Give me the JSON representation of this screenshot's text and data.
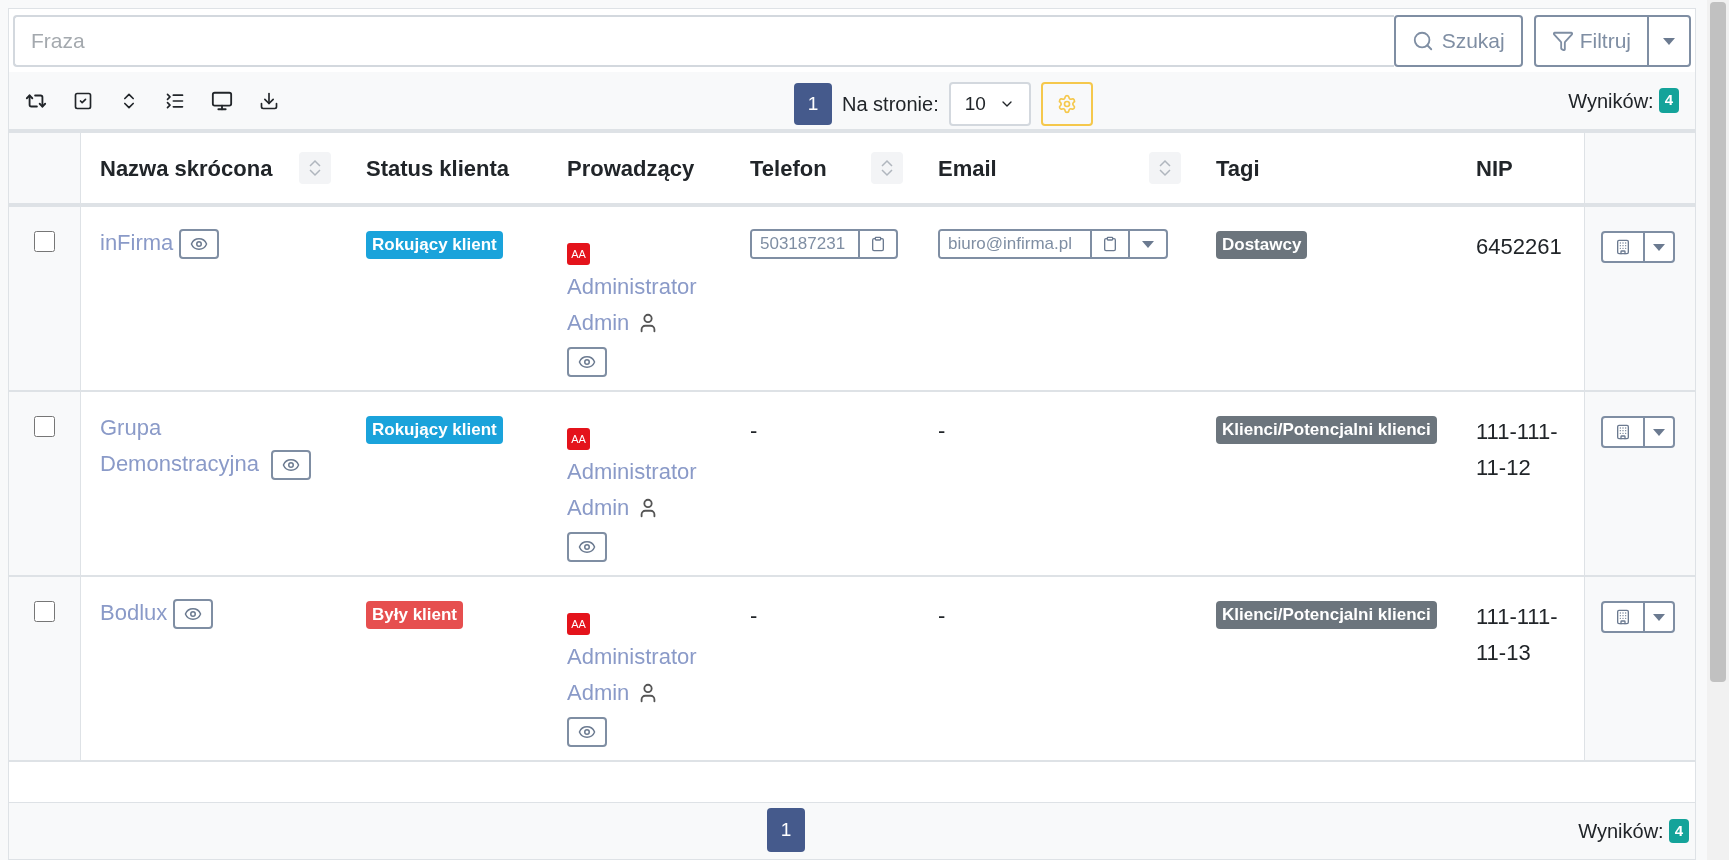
{
  "search": {
    "placeholder": "Fraza",
    "search_button": "Szukaj",
    "filter_button": "Filtruj"
  },
  "toolbar": {
    "page_button": "1",
    "per_page_label": "Na stronie:",
    "per_page_value": "10",
    "results_label": "Wyników:",
    "results_count": "4"
  },
  "table": {
    "columns": [
      {
        "label": "Nazwa skrócona",
        "sortable": true
      },
      {
        "label": "Status klienta",
        "sortable": false
      },
      {
        "label": "Prowadzący",
        "sortable": false
      },
      {
        "label": "Telefon",
        "sortable": true
      },
      {
        "label": "Email",
        "sortable": true
      },
      {
        "label": "Tagi",
        "sortable": false
      },
      {
        "label": "NIP",
        "sortable": false
      }
    ],
    "rows": [
      {
        "checked": false,
        "name": "inFirma",
        "status": "Rokujący klient",
        "color": "#1aa3db",
        "owner_initials": "AA",
        "owner": "Administrator Admin",
        "phone": {
          "kind": "copy",
          "value": "503187231"
        },
        "email": {
          "kind": "copy",
          "value": "biuro@infirma.pl"
        },
        "tag": "Dostawcy",
        "nip": "6452261"
      },
      {
        "checked": false,
        "name": "Grupa Demonstracyjna",
        "status": "Rokujący klient",
        "color": "#1aa3db",
        "owner_initials": "AA",
        "owner": "Administrator Admin",
        "phone": {
          "kind": "plain",
          "value": "-"
        },
        "email": {
          "kind": "plain",
          "value": "-"
        },
        "tag": "Klienci/Potencjalni klienci",
        "nip": "111-111-11-12"
      },
      {
        "checked": false,
        "name": "Bodlux",
        "status": "Były klient",
        "color": "#e64f4f",
        "owner_initials": "AA",
        "owner": "Administrator Admin",
        "phone": {
          "kind": "plain",
          "value": "-"
        },
        "email": {
          "kind": "plain",
          "value": "-"
        },
        "tag": "Klienci/Potencjalni klienci",
        "nip": "111-111-11-13"
      }
    ]
  },
  "footer": {
    "page_button": "1",
    "results_label": "Wyników:",
    "results_count": "4"
  }
}
